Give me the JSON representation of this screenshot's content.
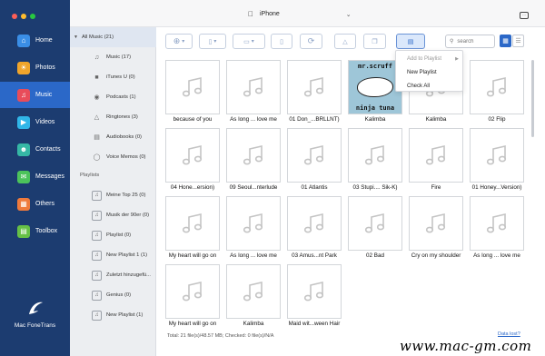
{
  "window": {
    "device_name": "iPhone"
  },
  "nav": {
    "items": [
      {
        "label": "Home",
        "icon": "home-icon",
        "color": "#3a8ee6"
      },
      {
        "label": "Photos",
        "icon": "photos-icon",
        "color": "#f0a52b"
      },
      {
        "label": "Music",
        "icon": "music-icon",
        "color": "#e84c5a"
      },
      {
        "label": "Videos",
        "icon": "videos-icon",
        "color": "#30b6e8"
      },
      {
        "label": "Contacts",
        "icon": "contacts-icon",
        "color": "#35b7a5"
      },
      {
        "label": "Messages",
        "icon": "messages-icon",
        "color": "#4cc35b"
      },
      {
        "label": "Others",
        "icon": "others-icon",
        "color": "#ef7a3c"
      },
      {
        "label": "Toolbox",
        "icon": "toolbox-icon",
        "color": "#66c046"
      }
    ],
    "active": "Music",
    "brand": "Mac FoneTrans"
  },
  "tree": {
    "all_music": "All Music (21)",
    "library": [
      {
        "label": "Music (17)",
        "icon": "note-icon"
      },
      {
        "label": "iTunes U (0)",
        "icon": "itunes-u-icon"
      },
      {
        "label": "Podcasts (1)",
        "icon": "podcast-icon"
      },
      {
        "label": "Ringtones (3)",
        "icon": "bell-icon"
      },
      {
        "label": "Audiobooks (0)",
        "icon": "book-icon"
      },
      {
        "label": "Voice Memos (0)",
        "icon": "mic-icon"
      }
    ],
    "playlists_heading": "Playlists",
    "playlists": [
      "Meine Top 25 (0)",
      "Musik der 90er (0)",
      "Playlist (0)",
      "New Playlist 1 (1)",
      "Zuletzt hinzugefü...",
      "Genius (0)",
      "New Playlist (1)"
    ]
  },
  "toolbar": {
    "search_placeholder": "search"
  },
  "dropdown": {
    "items": [
      {
        "label": "Add to Playlist",
        "disabled": true,
        "submenu": true
      },
      {
        "label": "New Playlist",
        "disabled": false,
        "submenu": false
      },
      {
        "label": "Check All",
        "disabled": false,
        "submenu": false
      }
    ]
  },
  "grid": {
    "tiles": [
      "because of you",
      "As long ... love me",
      "01 Don_...BRLLNT)",
      "Kalimba",
      "Kalimba",
      "02 Flip",
      "04 Hone...ersion)",
      "09 Seoul...nterlude",
      "01 Atlantis",
      "03 Stupi.... Sik-K)",
      "Fire",
      "01 Honey...Version)",
      "My heart will go on",
      "As long ... love me",
      "03 Amus...nt Park",
      "02 Bad",
      "Cry on my shoulder",
      "As long ... love me",
      "My heart will go on",
      "Kalimba",
      "Maid wit...ween Hair"
    ],
    "art_tile_index": 3,
    "art_text_top": "mr.scruff",
    "art_text_bottom": "ninja tuna"
  },
  "status": {
    "total": "Total: 21 file(s)/48.57 MB; Checked: 0 file(s)/N/A",
    "data_lost": "Data lost?"
  },
  "watermark": "www.mac-gm.com",
  "colors": {
    "nav_bg": "#1c3c70",
    "nav_active": "#2b68c8",
    "accent": "#2b68c8"
  }
}
